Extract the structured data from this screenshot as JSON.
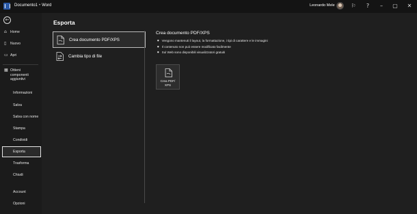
{
  "titlebar": {
    "doc_name": "Documento1",
    "separator": "•",
    "app_name": "Word",
    "user": "Leonardo Mele",
    "icons": [
      "word-logo-icon",
      "feedback-icon",
      "help-icon",
      "minimize-icon",
      "maximize-icon",
      "close-icon"
    ],
    "help_glyph": "?",
    "min_glyph": "–",
    "max_glyph": "▢",
    "close_glyph": "✕",
    "feedback_glyph": "⚐"
  },
  "sidebar": {
    "back_glyph": "←",
    "items": [
      {
        "label": "Home",
        "icon": "home-icon",
        "glyph": "⌂"
      },
      {
        "label": "Nuovo",
        "icon": "new-document-icon",
        "glyph": "▯"
      },
      {
        "label": "Apri",
        "icon": "folder-open-icon",
        "glyph": "▭"
      },
      {
        "label": "Ottieni componenti aggiuntivi",
        "icon": "addins-grid-icon",
        "glyph": "▦"
      },
      {
        "label": "Informazioni"
      },
      {
        "label": "Salva"
      },
      {
        "label": "Salva con nome"
      },
      {
        "label": "Stampa"
      },
      {
        "label": "Condividi"
      },
      {
        "label": "Esporta",
        "selected": true
      },
      {
        "label": "Trasforma"
      },
      {
        "label": "Chiudi"
      },
      {
        "label": "Account"
      },
      {
        "label": "Opzioni"
      }
    ]
  },
  "main": {
    "heading": "Esporta",
    "options": [
      {
        "label": "Crea documento PDF/XPS",
        "icon": "pdf-document-icon",
        "selected": true
      },
      {
        "label": "Cambia tipo di file",
        "icon": "change-file-type-icon",
        "selected": false
      }
    ],
    "pane": {
      "title": "Crea documento PDF/XPS",
      "bullets": [
        "Vengono mantenuti il layout, la formattazione, i tipi di carattere e le immagini",
        "Il contenuto non può essere modificato facilmente",
        "Sul Web sono disponibili visualizzatori gratuiti"
      ],
      "button_label": "Crea PDF/ XPS",
      "button_icon": "create-pdf-icon"
    }
  },
  "colors": {
    "sidebar_bg": "#1b1b1b",
    "main_bg": "#1f1f1f",
    "titlebar_bg": "#141414",
    "word_blue": "#2b5aa8"
  }
}
